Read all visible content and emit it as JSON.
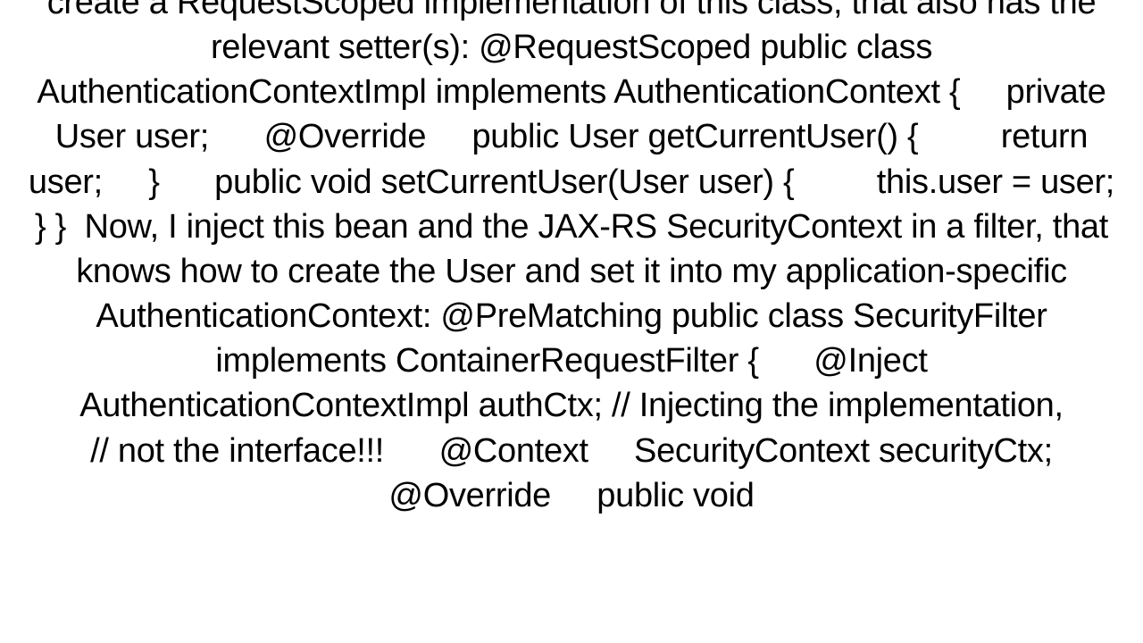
{
  "document": {
    "text": "create a RequestScoped implementation of this class, that also has the relevant setter(s): @RequestScoped public class AuthenticationContextImpl implements AuthenticationContext {     private User user;      @Override     public User getCurrentUser() {         return user;     }      public void setCurrentUser(User user) {         this.user = user;     } }  Now, I inject this bean and the JAX-RS SecurityContext in a filter, that knows how to create the User and set it into my application-specific AuthenticationContext: @PreMatching public class SecurityFilter implements ContainerRequestFilter {      @Inject     AuthenticationContextImpl authCtx; // Injecting the implementation,                                         // not the interface!!!      @Context     SecurityContext securityCtx;      @Override     public void"
  }
}
